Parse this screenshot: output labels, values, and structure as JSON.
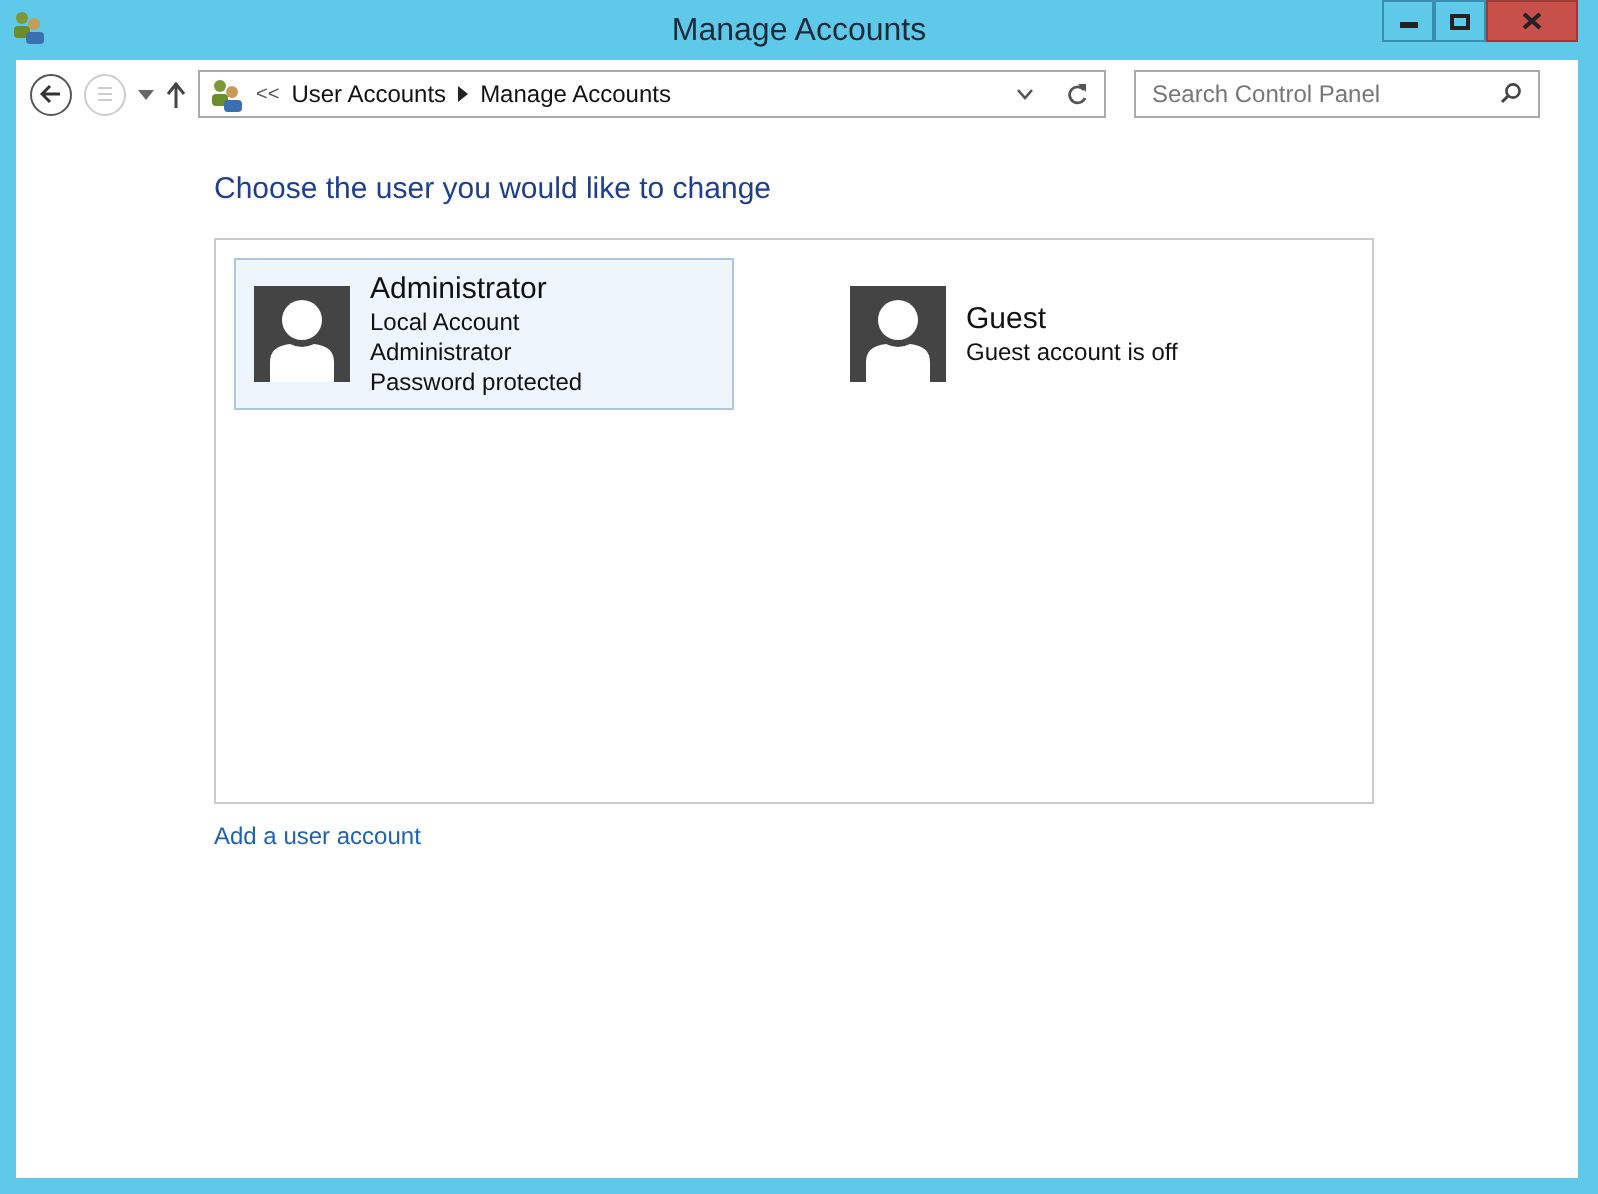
{
  "window": {
    "title": "Manage Accounts"
  },
  "address_bar": {
    "breadcrumbs": [
      "User Accounts",
      "Manage Accounts"
    ],
    "overflow": "<<"
  },
  "search": {
    "placeholder": "Search Control Panel"
  },
  "heading": "Choose the user you would like to change",
  "accounts": [
    {
      "name": "Administrator",
      "details": [
        "Local Account",
        "Administrator",
        "Password protected"
      ],
      "selected": true
    },
    {
      "name": "Guest",
      "details": [
        "Guest account is off"
      ],
      "selected": false
    }
  ],
  "add_link": "Add a user account"
}
